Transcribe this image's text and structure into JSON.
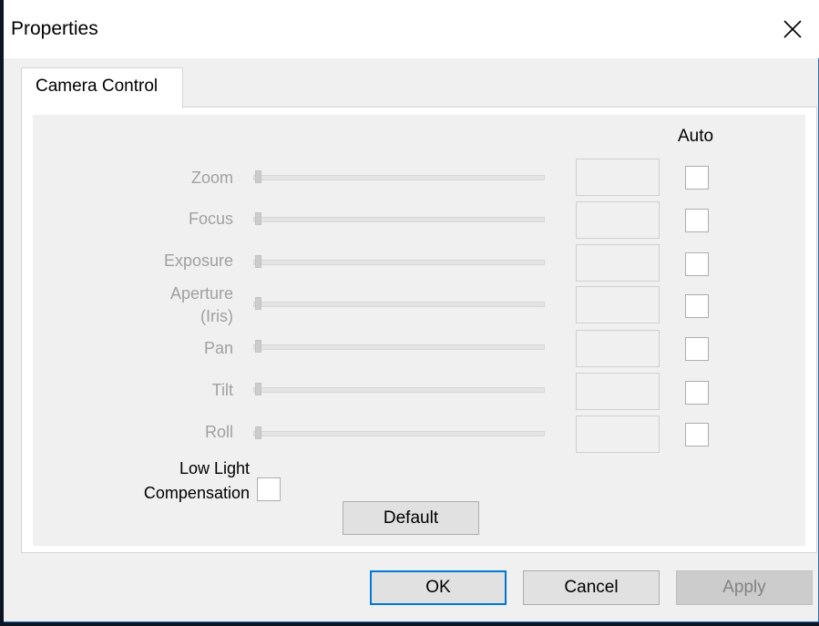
{
  "window": {
    "title": "Properties"
  },
  "tabs": [
    {
      "label": "Camera Control",
      "selected": true
    }
  ],
  "auto_header": "Auto",
  "controls": [
    {
      "label": "Zoom",
      "enabled": false,
      "value": "",
      "auto": false,
      "slider_level": 0
    },
    {
      "label": "Focus",
      "enabled": false,
      "value": "",
      "auto": false,
      "slider_level": 0
    },
    {
      "label": "Exposure",
      "enabled": false,
      "value": "",
      "auto": false,
      "slider_level": 0
    },
    {
      "label_line1": "Aperture",
      "label_line2": "(Iris)",
      "enabled": false,
      "value": "",
      "auto": false,
      "slider_level": 0
    },
    {
      "label": "Pan",
      "enabled": false,
      "value": "",
      "auto": false,
      "slider_level": 0
    },
    {
      "label": "Tilt",
      "enabled": false,
      "value": "",
      "auto": false,
      "slider_level": 0
    },
    {
      "label": "Roll",
      "enabled": false,
      "value": "",
      "auto": false,
      "slider_level": 0
    }
  ],
  "low_light": {
    "label_line1": "Low Light",
    "label_line2": "Compensation",
    "checked": false
  },
  "buttons": {
    "default": "Default",
    "ok": "OK",
    "cancel": "Cancel",
    "apply": "Apply"
  },
  "icons": {
    "close": "close-icon"
  },
  "colors": {
    "focus_border": "#0078d7",
    "disabled_text": "#a0a0a0",
    "background": "#0b1524"
  }
}
